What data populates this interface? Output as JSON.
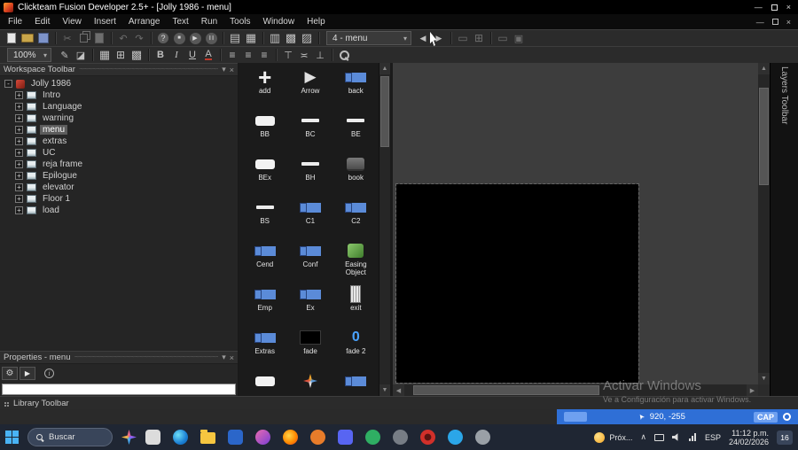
{
  "window": {
    "title": "Clickteam Fusion Developer 2.5+ - [Jolly 1986 - menu]"
  },
  "menubar": {
    "items": [
      "File",
      "Edit",
      "View",
      "Insert",
      "Arrange",
      "Text",
      "Run",
      "Tools",
      "Window",
      "Help"
    ]
  },
  "toolbar": {
    "frame_selector": "4 - menu",
    "zoom": "100%",
    "row1_left": [
      {
        "name": "new-icon"
      },
      {
        "name": "open-icon"
      },
      {
        "name": "save-icon"
      },
      {
        "name": "separator"
      },
      {
        "name": "cut-icon"
      },
      {
        "name": "copy-icon"
      },
      {
        "name": "paste-icon"
      },
      {
        "name": "separator"
      },
      {
        "name": "undo-icon"
      },
      {
        "name": "redo-icon"
      },
      {
        "name": "separator"
      },
      {
        "name": "help-icon"
      },
      {
        "name": "stop-icon"
      },
      {
        "name": "run-icon"
      },
      {
        "name": "step-icon"
      },
      {
        "name": "separator"
      },
      {
        "name": "storyboard-editor-icon"
      },
      {
        "name": "frame-editor-icon"
      },
      {
        "name": "separator"
      },
      {
        "name": "event-editor-icon"
      },
      {
        "name": "event-list-editor-icon"
      },
      {
        "name": "flowchart-icon"
      },
      {
        "name": "separator"
      }
    ],
    "row1_right": [
      {
        "name": "prev-frame-icon"
      },
      {
        "name": "next-frame-icon"
      },
      {
        "name": "separator"
      },
      {
        "name": "insert-object-icon"
      },
      {
        "name": "extension-icon"
      },
      {
        "name": "separator"
      },
      {
        "name": "frame-rect-icon"
      },
      {
        "name": "window-rect-icon"
      }
    ],
    "row2": [
      {
        "name": "pen-icon"
      },
      {
        "name": "fill-icon"
      },
      {
        "name": "separator"
      },
      {
        "name": "grid-icon"
      },
      {
        "name": "grid-snap-icon"
      },
      {
        "name": "grid-settings-icon"
      },
      {
        "name": "separator"
      },
      {
        "name": "bold-icon"
      },
      {
        "name": "italic-icon"
      },
      {
        "name": "underline-icon"
      },
      {
        "name": "text-color-icon"
      },
      {
        "name": "separator"
      },
      {
        "name": "align-left-icon"
      },
      {
        "name": "align-center-icon"
      },
      {
        "name": "align-right-icon"
      },
      {
        "name": "separator"
      },
      {
        "name": "align-top-icon"
      },
      {
        "name": "align-middle-icon"
      },
      {
        "name": "align-bottom-icon"
      },
      {
        "name": "separator"
      },
      {
        "name": "magnifier-icon"
      }
    ]
  },
  "workspace": {
    "title": "Workspace Toolbar",
    "root": "Jolly 1986",
    "items": [
      {
        "label": "Intro"
      },
      {
        "label": "Language"
      },
      {
        "label": "warning"
      },
      {
        "label": "menu",
        "state": "selected"
      },
      {
        "label": "extras"
      },
      {
        "label": "UC"
      },
      {
        "label": "reja frame"
      },
      {
        "label": "Epilogue"
      },
      {
        "label": "elevator"
      },
      {
        "label": "Floor 1"
      },
      {
        "label": "load"
      }
    ]
  },
  "properties": {
    "title": "Properties - menu",
    "input_value": ""
  },
  "library": {
    "bar_title": "Library Toolbar",
    "objects": [
      {
        "name": "add",
        "thumb": "plus"
      },
      {
        "name": "Arrow",
        "thumb": "triangle"
      },
      {
        "name": "back",
        "thumb": "counter"
      },
      {
        "name": "BB",
        "thumb": "pill"
      },
      {
        "name": "BC",
        "thumb": "dash"
      },
      {
        "name": "BE",
        "thumb": "dash"
      },
      {
        "name": "BEx",
        "thumb": "pill"
      },
      {
        "name": "BH",
        "thumb": "dash"
      },
      {
        "name": "book",
        "thumb": "book"
      },
      {
        "name": "BS",
        "thumb": "dash"
      },
      {
        "name": "C1",
        "thumb": "counter"
      },
      {
        "name": "C2",
        "thumb": "counter"
      },
      {
        "name": "Cend",
        "thumb": "counter"
      },
      {
        "name": "Conf",
        "thumb": "counter"
      },
      {
        "name": "Easing Object",
        "thumb": "easing"
      },
      {
        "name": "Emp",
        "thumb": "counter"
      },
      {
        "name": "Ex",
        "thumb": "counter"
      },
      {
        "name": "exit",
        "thumb": "door"
      },
      {
        "name": "Extras",
        "thumb": "counter"
      },
      {
        "name": "fade",
        "thumb": "black"
      },
      {
        "name": "fade 2",
        "thumb": "zero"
      },
      {
        "name": "",
        "thumb": "pill"
      },
      {
        "name": "",
        "thumb": "pinwheel"
      },
      {
        "name": "",
        "thumb": "counter"
      }
    ]
  },
  "layers": {
    "title": "Layers Toolbar"
  },
  "editor": {
    "watermark_line1": "Activar Windows",
    "watermark_line2": "Ve a Configuración para activar Windows."
  },
  "statusbar": {
    "coords": "920, -255",
    "cap": "CAP"
  },
  "taskbar": {
    "search_placeholder": "Buscar",
    "weather_label": "Próx...",
    "language": "ESP",
    "time": "11:12 p.m.",
    "date": "24/02/2026",
    "badge": "16",
    "apps": [
      {
        "name": "taskbar-app-1",
        "bg": "#dcdcdc",
        "shape": "sq"
      },
      {
        "name": "taskbar-app-2",
        "bg": "radial-gradient(circle at 35% 35%, #6ee0f7, #1b7fd4 60%, #0b5fa8)",
        "shape": "circle"
      },
      {
        "name": "taskbar-app-3",
        "bg": "#f6c640",
        "shape": "folder"
      },
      {
        "name": "taskbar-app-4",
        "bg": "#2b66c9",
        "shape": "sq"
      },
      {
        "name": "taskbar-app-5",
        "bg": "linear-gradient(135deg, #e86ab0, #7a3fd4)",
        "shape": "circle"
      },
      {
        "name": "taskbar-app-6",
        "bg": "radial-gradient(circle at 40% 40%, #ffd54a, #ff8a00 55%, #e33d23)",
        "shape": "circle"
      },
      {
        "name": "taskbar-app-7",
        "bg": "#e87c2a",
        "shape": "circle"
      },
      {
        "name": "taskbar-app-8",
        "bg": "#5865f2",
        "shape": "sq"
      },
      {
        "name": "taskbar-app-9",
        "bg": "#2fae63",
        "shape": "circle"
      },
      {
        "name": "taskbar-app-10",
        "bg": "#777d85",
        "shape": "circle"
      },
      {
        "name": "taskbar-app-11",
        "bg": "radial-gradient(circle, #5a1411 30%, #d1302a 34%)",
        "shape": "circle"
      },
      {
        "name": "taskbar-app-12",
        "bg": "#2ba6e8",
        "shape": "circle"
      },
      {
        "name": "taskbar-app-13",
        "bg": "#9aa0a6",
        "shape": "circle"
      }
    ]
  }
}
